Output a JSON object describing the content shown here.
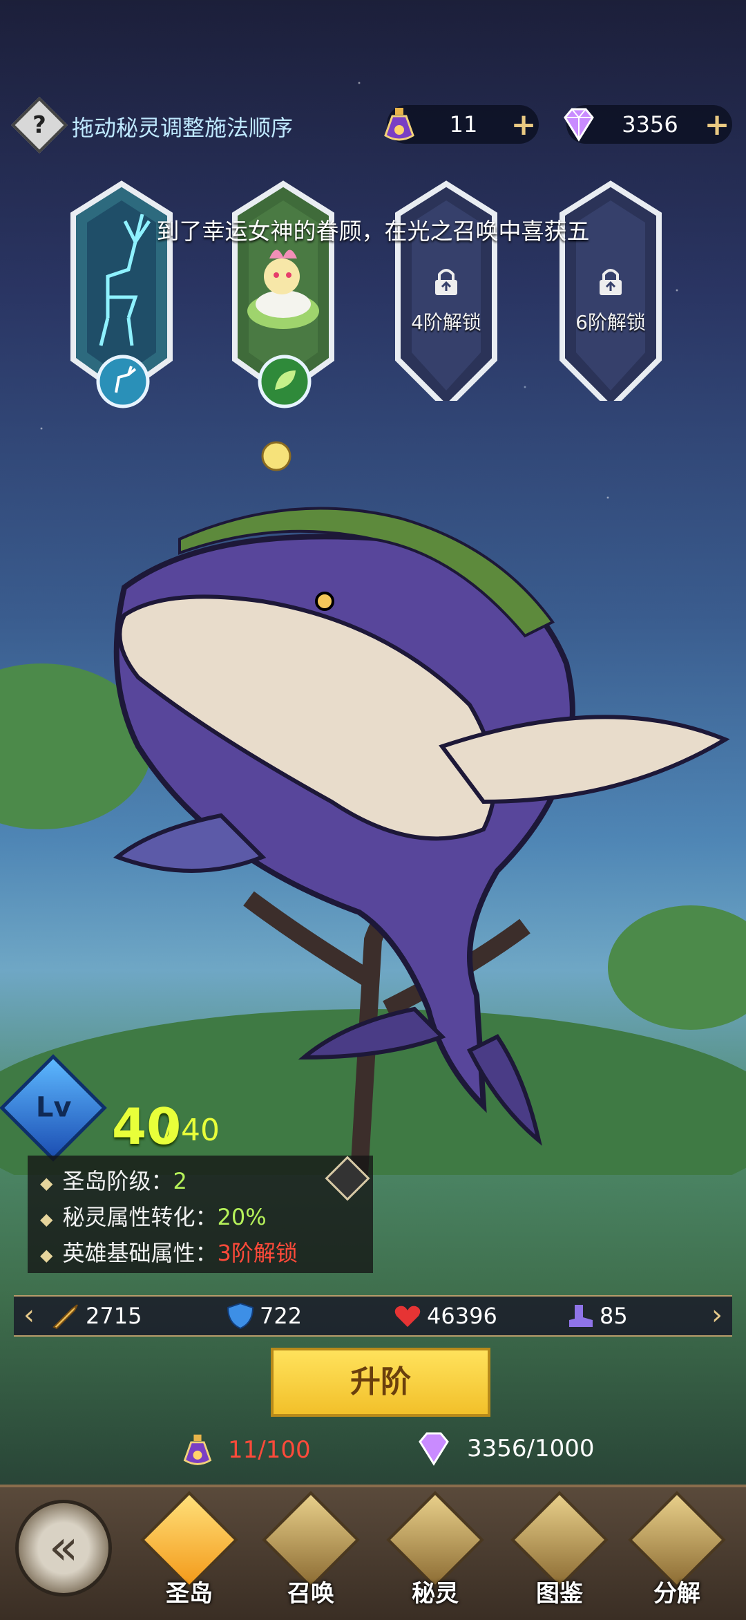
{
  "top": {
    "hint": "拖动秘灵调整施法顺序",
    "potion_count": "11",
    "diamond_count": "3356",
    "plus": "+"
  },
  "toast": "到了幸运女神的眷顾，在光之召唤中喜获五",
  "slots": [
    {
      "state": "deer spirit equipped"
    },
    {
      "state": "flower spirit equipped"
    },
    {
      "label": "4阶解锁"
    },
    {
      "label": "6阶解锁"
    }
  ],
  "level": {
    "badge": "Lv",
    "current": "40",
    "slash": "/",
    "max": "40"
  },
  "info": {
    "rank_label": "圣岛阶级：",
    "rank_value": "2",
    "convert_label": "秘灵属性转化：",
    "convert_value": "20%",
    "hero_label": "英雄基础属性：",
    "hero_value": "3阶解锁"
  },
  "stats": {
    "attack": "2715",
    "defense": "722",
    "hp": "46396",
    "speed": "85"
  },
  "upgrade_label": "升阶",
  "costs": {
    "potion": "11/100",
    "diamond": "3356/1000"
  },
  "nav": {
    "tabs": [
      "圣岛",
      "召唤",
      "秘灵",
      "图鉴",
      "分解"
    ],
    "active": "圣岛"
  },
  "colors": {
    "level": "#e8ff3a",
    "green_value": "#b6f25a",
    "red_value": "#ff4a3a",
    "button": "#f2c02a"
  }
}
